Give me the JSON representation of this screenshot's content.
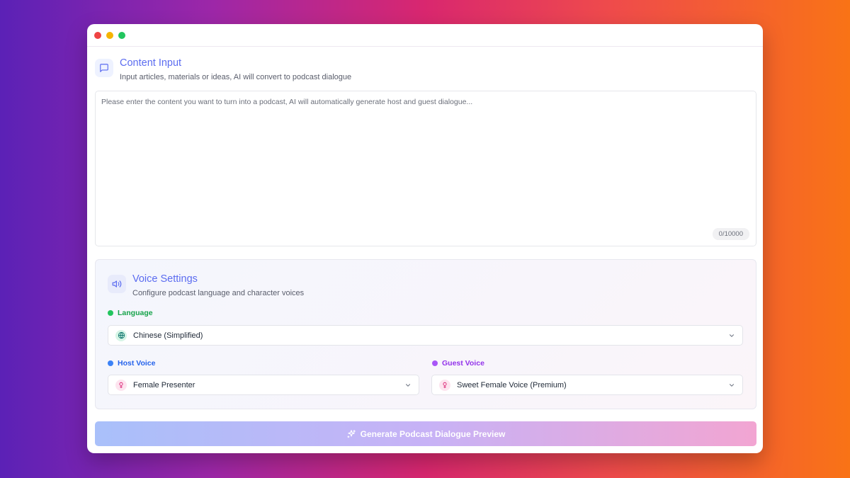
{
  "content_input": {
    "title": "Content Input",
    "subtitle": "Input articles, materials or ideas, AI will convert to podcast dialogue",
    "placeholder": "Please enter the content you want to turn into a podcast, AI will automatically generate host and guest dialogue...",
    "value": "",
    "char_count": "0/10000",
    "icon": "message-square-icon"
  },
  "voice_settings": {
    "title": "Voice Settings",
    "subtitle": "Configure podcast language and character voices",
    "icon": "speaker-icon",
    "language": {
      "label": "Language",
      "selected": "Chinese (Simplified)",
      "icon": "globe-icon",
      "color": "#22c55e"
    },
    "host_voice": {
      "label": "Host Voice",
      "selected": "Female Presenter",
      "icon": "female-icon",
      "color": "#3b82f6"
    },
    "guest_voice": {
      "label": "Guest Voice",
      "selected": "Sweet Female Voice (Premium)",
      "icon": "female-icon",
      "color": "#a855f7"
    }
  },
  "generate_button": {
    "label": "Generate Podcast Dialogue Preview",
    "icon": "sparkles-icon"
  },
  "colors": {
    "accent": "#5b6cf0",
    "window_bg": "#ffffff"
  }
}
